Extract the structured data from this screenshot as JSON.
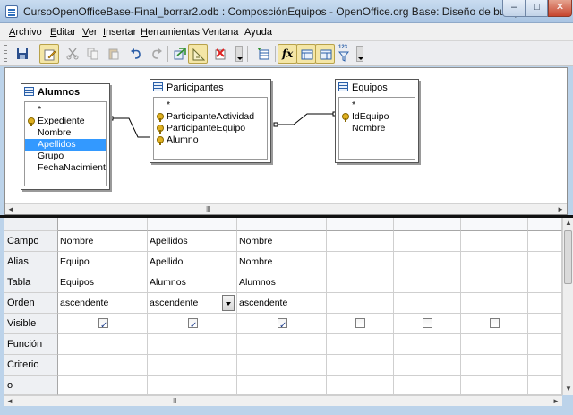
{
  "window": {
    "title": "CursoOpenOfficeBase-Final_borrar2.odb : ComposciónEquipos - OpenOffice.org Base: Diseño de busqueda",
    "minimize_glyph": "–",
    "maximize_glyph": "□",
    "close_glyph": "✕"
  },
  "menu": [
    {
      "mnemonic": "A",
      "rest": "rchivo"
    },
    {
      "mnemonic": "E",
      "rest": "ditar"
    },
    {
      "mnemonic": "V",
      "rest": "er"
    },
    {
      "mnemonic": "I",
      "rest": "nsertar"
    },
    {
      "mnemonic": "H",
      "rest": "erramientas"
    },
    {
      "mnemonic": "",
      "rest": "Ventana"
    },
    {
      "mnemonic": "",
      "rest": "Ayuda"
    }
  ],
  "menu_text": [
    "Archivo",
    "Editar",
    "Ver",
    "Insertar",
    "Herramientas",
    "Ventana",
    "Ayuda"
  ],
  "toolbar": {
    "icons": [
      "save-icon",
      "edit-mode-icon",
      "cut-icon",
      "copy-icon",
      "paste-icon",
      "undo-icon",
      "redo-icon",
      "run-query-icon",
      "sql-design-icon",
      "delete-icon",
      "add-table-icon",
      "functions-icon",
      "table-name-icon",
      "alias-icon",
      "distinct-icon"
    ],
    "functions_glyph": "fx",
    "distinct_glyph": "123"
  },
  "tables": {
    "alumnos": {
      "name": "Alumnos",
      "fields": [
        "*",
        "Expediente",
        "Nombre",
        "Apellidos",
        "Grupo",
        "FechaNacimiento"
      ],
      "keys": [
        1
      ],
      "selected": 3
    },
    "participantes": {
      "name": "Participantes",
      "fields": [
        "*",
        "ParticipanteActividad",
        "ParticipanteEquipo",
        "Alumno"
      ],
      "keys": [
        1,
        2,
        3
      ]
    },
    "equipos": {
      "name": "Equipos",
      "fields": [
        "*",
        "IdEquipo",
        "Nombre"
      ],
      "keys": [
        1
      ]
    }
  },
  "scroll": {
    "left": "◄",
    "right": "►",
    "up": "▲",
    "down": "▼",
    "grip": "III"
  },
  "grid": {
    "row_labels": [
      "Campo",
      "Alias",
      "Tabla",
      "Orden",
      "Visible",
      "Función",
      "Criterio",
      "o"
    ],
    "columns": [
      {
        "campo": "Nombre",
        "alias": "Equipo",
        "tabla": "Equipos",
        "orden": "ascendente",
        "visible": true
      },
      {
        "campo": "Apellidos",
        "alias": "Apellido",
        "tabla": "Alumnos",
        "orden": "ascendente",
        "visible": true
      },
      {
        "campo": "Nombre",
        "alias": "Nombre",
        "tabla": "Alumnos",
        "orden": "ascendente",
        "visible": true
      },
      {
        "campo": "",
        "alias": "",
        "tabla": "",
        "orden": "",
        "visible": false
      },
      {
        "campo": "",
        "alias": "",
        "tabla": "",
        "orden": "",
        "visible": false
      },
      {
        "campo": "",
        "alias": "",
        "tabla": "",
        "orden": "",
        "visible": false
      },
      {
        "campo": "",
        "alias": "",
        "tabla": "",
        "orden": "",
        "visible": false
      }
    ]
  },
  "colors": {
    "selection": "#3399ff",
    "title_gradient_top": "#c9dcf0",
    "close_button": "#c7452e"
  }
}
